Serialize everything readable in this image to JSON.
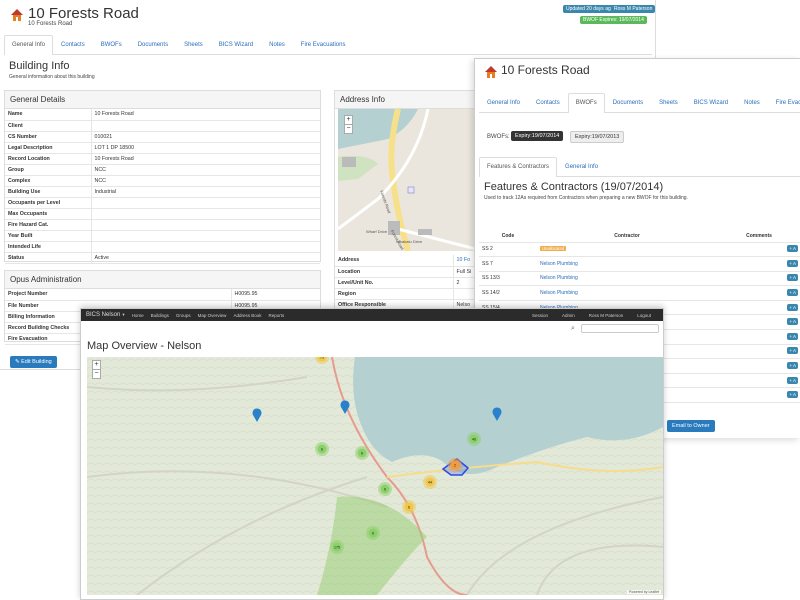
{
  "main": {
    "title": "10 Forests Road",
    "subtitle": "10 Forests Road",
    "badge_updated": "Updated 20 days ago",
    "badge_user": "Ross M Paterson",
    "badge_bwof": "BWOF Expires: 19/07/2014",
    "tabs": [
      "General Info",
      "Contacts",
      "BWOFs",
      "Documents",
      "Sheets",
      "BICS Wizard",
      "Notes",
      "Fire Evacuations"
    ],
    "heading": "Building Info",
    "note": "General information about this building",
    "general": {
      "title": "General Details",
      "rows": [
        [
          "Name",
          "10 Forests Road"
        ],
        [
          "Client",
          ""
        ],
        [
          "CS Number",
          "010021"
        ],
        [
          "Legal Description",
          "LOT 1 DP 18500"
        ],
        [
          "Record Location",
          "10 Forests Road"
        ],
        [
          "Group",
          "NCC"
        ],
        [
          "Complex",
          "NCC"
        ],
        [
          "Building Use",
          "Industrial"
        ],
        [
          "Occupants per Level",
          ""
        ],
        [
          "Max Occupants",
          ""
        ],
        [
          "Fire Hazard Cat.",
          ""
        ],
        [
          "Year Built",
          ""
        ],
        [
          "Intended Life",
          ""
        ],
        [
          "Status",
          "Active"
        ]
      ]
    },
    "opus": {
      "title": "Opus Administration",
      "rows": [
        [
          "Project Number",
          "H0095.95"
        ],
        [
          "File Number",
          "H0095.95"
        ],
        [
          "Billing Information",
          ""
        ],
        [
          "Record Building Checks",
          ""
        ],
        [
          "Fire Evacuation",
          ""
        ]
      ]
    },
    "edit_button": "Edit Building",
    "address": {
      "title": "Address Info",
      "rows": [
        [
          "Address",
          "10 Fo"
        ],
        [
          "Location",
          "Full Si"
        ],
        [
          "Level/Unit No.",
          "2"
        ],
        [
          "Region",
          ""
        ],
        [
          "Office Responsible",
          "Nelso"
        ]
      ],
      "roads": [
        "Forest Road",
        "Forests Road",
        "Whakatu Drive",
        "Wharf Drive"
      ]
    }
  },
  "bwof": {
    "title": "10 Forests Road",
    "tabs": [
      "General Info",
      "Contacts",
      "BWOFs",
      "Documents",
      "Sheets",
      "BICS Wizard",
      "Notes",
      "Fire Evacuations"
    ],
    "label": "BWOFs:",
    "expiry_active": "Expiry:19/07/2014",
    "expiry_other": "Expiry:19/07/2013",
    "subtabs": [
      "Features & Contractors",
      "General Info"
    ],
    "heading": "Features & Contractors (19/07/2014)",
    "note": "Used to track 12As required from Contractors when preparing a new BWOF for this building.",
    "cols": [
      "Code",
      "Contractor",
      "Comments"
    ],
    "rows": [
      [
        "SS 2",
        "Unallocated"
      ],
      [
        "SS 7",
        "Nelson Plumbing"
      ],
      [
        "SS 13/3",
        "Nelson Plumbing"
      ],
      [
        "SS 14/2",
        "Nelson Plumbing"
      ],
      [
        "SS 15/4",
        "Nelson Plumbing"
      ],
      [
        "",
        ""
      ],
      [
        "",
        ""
      ],
      [
        "",
        ""
      ],
      [
        "",
        ""
      ],
      [
        "",
        ""
      ],
      [
        "",
        ""
      ]
    ],
    "add_label": "+ A",
    "email_button": "Email to Owner"
  },
  "mapwin": {
    "brand": "BICS Nelson",
    "nav": [
      "Home",
      "Buildings",
      "Groups",
      "Map Overview",
      "Address Book",
      "Reports"
    ],
    "nav_right": [
      "Session",
      "Admin",
      "Ross M Paterson",
      "Logout"
    ],
    "heading": "Map Overview - Nelson",
    "attribution": "Powered by Leaflet",
    "clusters": [
      "73",
      "6",
      "6",
      "6",
      "6",
      "44",
      "46",
      "2",
      "175",
      "6"
    ]
  }
}
